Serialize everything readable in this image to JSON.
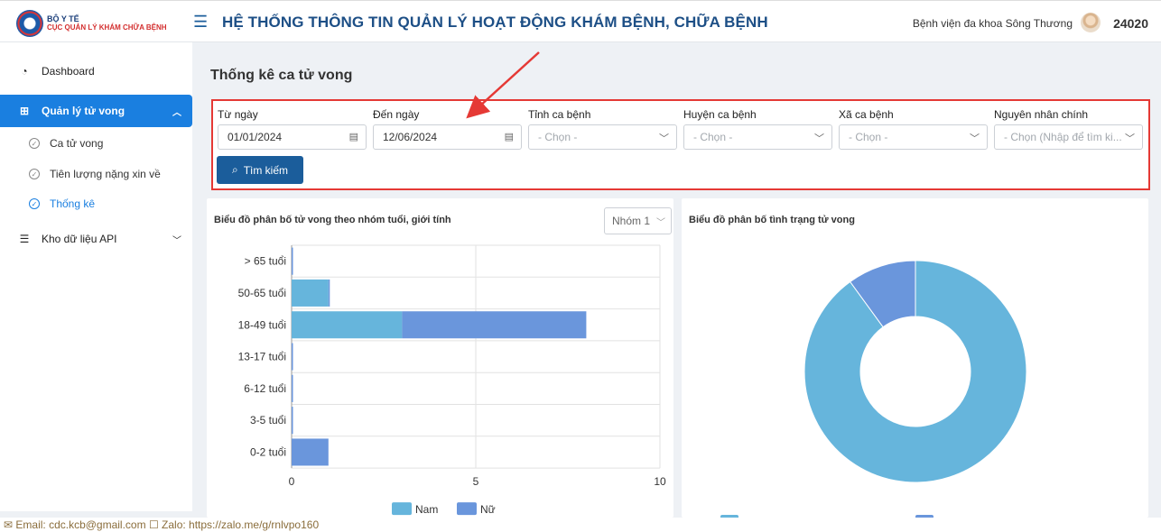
{
  "header": {
    "logo_line1": "BỘ Y TẾ",
    "logo_line2": "CỤC QUẢN LÝ KHÁM CHỮA BỆNH",
    "app_title": "HỆ THỐNG THÔNG TIN QUẢN LÝ HOẠT ĐỘNG KHÁM BỆNH, CHỮA BỆNH",
    "hospital": "Bệnh viện đa khoa Sông Thương",
    "user_code": "24020"
  },
  "sidebar": {
    "dashboard": "Dashboard",
    "death_mgmt": "Quản lý tử vong",
    "sub_death_cases": "Ca tử vong",
    "sub_prognosis": "Tiên lượng nặng xin về",
    "sub_statistics": "Thống kê",
    "api_data": "Kho dữ liệu API"
  },
  "page_title": "Thống kê ca tử vong",
  "filters": {
    "from_label": "Từ ngày",
    "from_value": "01/01/2024",
    "to_label": "Đến ngày",
    "to_value": "12/06/2024",
    "province_label": "Tỉnh ca bệnh",
    "province_placeholder": "- Chọn -",
    "district_label": "Huyện ca bệnh",
    "district_placeholder": "- Chọn -",
    "commune_label": "Xã ca bệnh",
    "commune_placeholder": "- Chọn -",
    "cause_label": "Nguyên nhân chính",
    "cause_placeholder": "- Chọn (Nhập để tìm ki...",
    "search_button": "Tìm kiếm"
  },
  "age_chart_card": {
    "title": "Biểu đồ phân bố tử vong theo nhóm tuổi, giới tính",
    "group_select": "Nhóm 1"
  },
  "status_chart_card": {
    "title": "Biểu đồ phân bố tình trạng tử vong"
  },
  "footer": {
    "text": "✉ Email: cdc.kcb@gmail.com  ☐ Zalo: https://zalo.me/g/rnlvpo160"
  },
  "colors": {
    "primary": "#1b5d9b",
    "active_nav": "#1a7fe0",
    "highlight_border": "#e53935",
    "male": "#66b5dc",
    "female": "#6a96dc"
  },
  "chart_data": [
    {
      "type": "bar",
      "orientation": "horizontal",
      "stacked": true,
      "categories": [
        "> 65 tuổi",
        "50-65 tuổi",
        "18-49 tuổi",
        "13-17 tuổi",
        "6-12 tuổi",
        "3-5 tuổi",
        "0-2 tuổi"
      ],
      "series": [
        {
          "name": "Nam",
          "values": [
            0,
            1,
            3,
            0,
            0,
            0,
            0
          ],
          "color": "#66b5dc"
        },
        {
          "name": "Nữ",
          "values": [
            0,
            0,
            5,
            0,
            0,
            0,
            1
          ],
          "color": "#6a96dc"
        }
      ],
      "xticks": [
        "0",
        "5",
        "10"
      ],
      "xlim": [
        0,
        10
      ],
      "grid": true,
      "legend": "bottom"
    },
    {
      "type": "pie",
      "donut": true,
      "slices": [
        {
          "value": 90,
          "color": "#66b5dc"
        },
        {
          "value": 10,
          "color": "#6a96dc"
        }
      ],
      "legend": "bottom"
    }
  ]
}
